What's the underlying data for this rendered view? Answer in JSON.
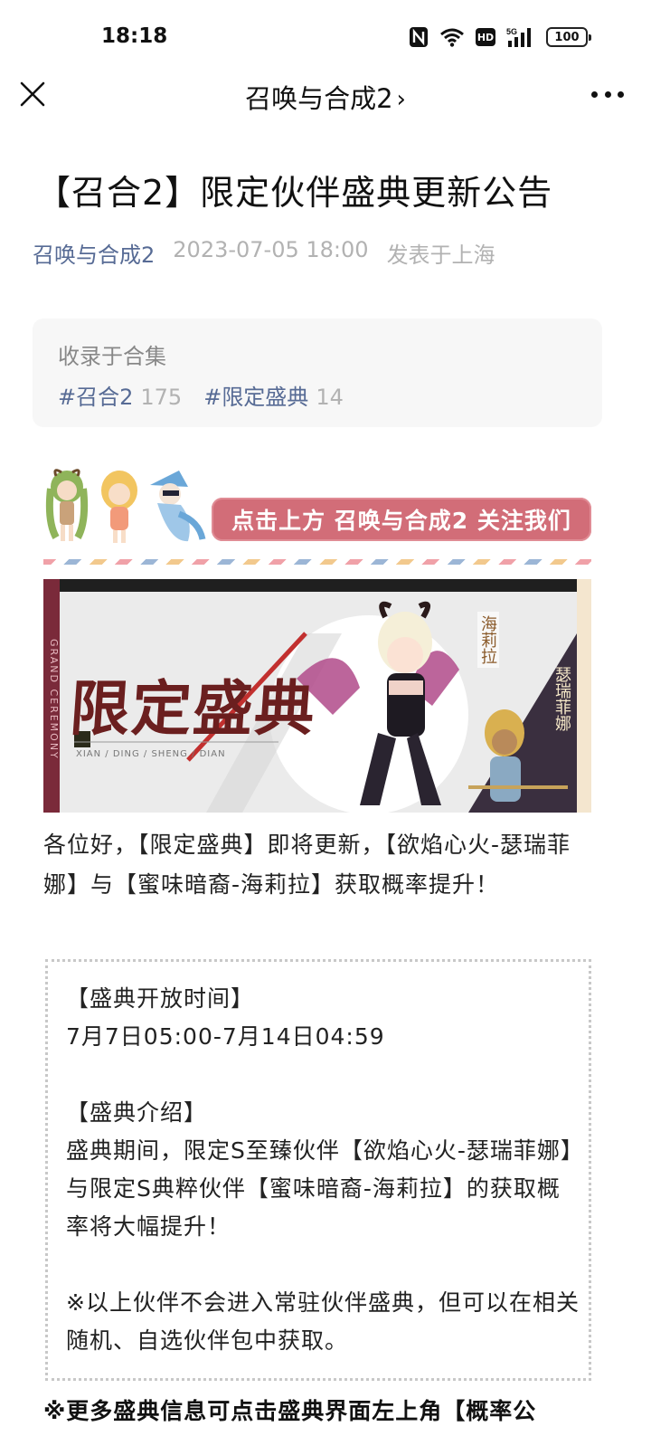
{
  "status_bar": {
    "time": "18:18",
    "battery": "100",
    "icons": [
      "nfc-icon",
      "wifi-icon",
      "hd-icon",
      "signal-5g-icon",
      "battery-icon"
    ]
  },
  "nav": {
    "title": "召唤与合成2",
    "chevron": "›",
    "icons": [
      "close-icon",
      "more-icon"
    ]
  },
  "article": {
    "title": "【召合2】限定伙伴盛典更新公告",
    "account": "召唤与合成2",
    "date": "2023-07-05 18:00",
    "location": "发表于上海"
  },
  "collection": {
    "label": "收录于合集",
    "tags": [
      {
        "name": "#召合2",
        "count": "175"
      },
      {
        "name": "#限定盛典",
        "count": "14"
      }
    ]
  },
  "follow_banner": {
    "text": "点击上方 召唤与合成2 关注我们"
  },
  "hero": {
    "title": "限定盛典",
    "subtitle": "XIAN / DING / SHENG / DIAN",
    "side_text": "GRAND CEREMONY",
    "name_1": "海莉拉",
    "name_2": "瑟瑞菲娜"
  },
  "intro": "各位好，【限定盛典】即将更新，【欲焰心火-瑟瑞菲娜】与【蜜味暗裔-海莉拉】获取概率提升！",
  "info": {
    "time_header": "【盛典开放时间】",
    "time_value": "7月7日05:00-7月14日04:59",
    "intro_header": "【盛典介绍】",
    "intro_text": "盛典期间，限定S至臻伙伴【欲焰心火-瑟瑞菲娜】与限定S典粹伙伴【蜜味暗裔-海莉拉】的获取概率将大幅提升！",
    "note": "※以上伙伴不会进入常驻伙伴盛典，但可以在相关随机、自选伙伴包中获取。"
  },
  "tail": "※更多盛典信息可点击盛典界面左上角【概率公"
}
